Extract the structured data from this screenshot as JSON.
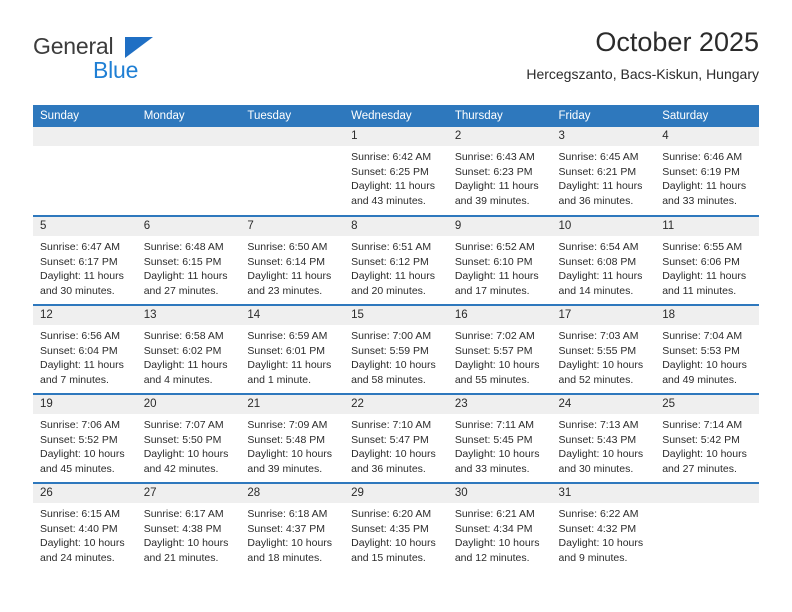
{
  "logo": {
    "word1": "General",
    "word2": "Blue",
    "triangle_color": "#1f6fc4",
    "word2_color": "#1f7fd4"
  },
  "header": {
    "title": "October 2025",
    "subtitle": "Hercegszanto, Bacs-Kiskun, Hungary"
  },
  "theme": {
    "header_blue": "#2e78bd",
    "daynum_gray": "#efefef",
    "text": "#2b2b2b"
  },
  "weekday_headers": [
    "Sunday",
    "Monday",
    "Tuesday",
    "Wednesday",
    "Thursday",
    "Friday",
    "Saturday"
  ],
  "weeks": [
    [
      {
        "day": "",
        "sunrise": "",
        "sunset": "",
        "daylight": ""
      },
      {
        "day": "",
        "sunrise": "",
        "sunset": "",
        "daylight": ""
      },
      {
        "day": "",
        "sunrise": "",
        "sunset": "",
        "daylight": ""
      },
      {
        "day": "1",
        "sunrise": "Sunrise: 6:42 AM",
        "sunset": "Sunset: 6:25 PM",
        "daylight": "Daylight: 11 hours and 43 minutes."
      },
      {
        "day": "2",
        "sunrise": "Sunrise: 6:43 AM",
        "sunset": "Sunset: 6:23 PM",
        "daylight": "Daylight: 11 hours and 39 minutes."
      },
      {
        "day": "3",
        "sunrise": "Sunrise: 6:45 AM",
        "sunset": "Sunset: 6:21 PM",
        "daylight": "Daylight: 11 hours and 36 minutes."
      },
      {
        "day": "4",
        "sunrise": "Sunrise: 6:46 AM",
        "sunset": "Sunset: 6:19 PM",
        "daylight": "Daylight: 11 hours and 33 minutes."
      }
    ],
    [
      {
        "day": "5",
        "sunrise": "Sunrise: 6:47 AM",
        "sunset": "Sunset: 6:17 PM",
        "daylight": "Daylight: 11 hours and 30 minutes."
      },
      {
        "day": "6",
        "sunrise": "Sunrise: 6:48 AM",
        "sunset": "Sunset: 6:15 PM",
        "daylight": "Daylight: 11 hours and 27 minutes."
      },
      {
        "day": "7",
        "sunrise": "Sunrise: 6:50 AM",
        "sunset": "Sunset: 6:14 PM",
        "daylight": "Daylight: 11 hours and 23 minutes."
      },
      {
        "day": "8",
        "sunrise": "Sunrise: 6:51 AM",
        "sunset": "Sunset: 6:12 PM",
        "daylight": "Daylight: 11 hours and 20 minutes."
      },
      {
        "day": "9",
        "sunrise": "Sunrise: 6:52 AM",
        "sunset": "Sunset: 6:10 PM",
        "daylight": "Daylight: 11 hours and 17 minutes."
      },
      {
        "day": "10",
        "sunrise": "Sunrise: 6:54 AM",
        "sunset": "Sunset: 6:08 PM",
        "daylight": "Daylight: 11 hours and 14 minutes."
      },
      {
        "day": "11",
        "sunrise": "Sunrise: 6:55 AM",
        "sunset": "Sunset: 6:06 PM",
        "daylight": "Daylight: 11 hours and 11 minutes."
      }
    ],
    [
      {
        "day": "12",
        "sunrise": "Sunrise: 6:56 AM",
        "sunset": "Sunset: 6:04 PM",
        "daylight": "Daylight: 11 hours and 7 minutes."
      },
      {
        "day": "13",
        "sunrise": "Sunrise: 6:58 AM",
        "sunset": "Sunset: 6:02 PM",
        "daylight": "Daylight: 11 hours and 4 minutes."
      },
      {
        "day": "14",
        "sunrise": "Sunrise: 6:59 AM",
        "sunset": "Sunset: 6:01 PM",
        "daylight": "Daylight: 11 hours and 1 minute."
      },
      {
        "day": "15",
        "sunrise": "Sunrise: 7:00 AM",
        "sunset": "Sunset: 5:59 PM",
        "daylight": "Daylight: 10 hours and 58 minutes."
      },
      {
        "day": "16",
        "sunrise": "Sunrise: 7:02 AM",
        "sunset": "Sunset: 5:57 PM",
        "daylight": "Daylight: 10 hours and 55 minutes."
      },
      {
        "day": "17",
        "sunrise": "Sunrise: 7:03 AM",
        "sunset": "Sunset: 5:55 PM",
        "daylight": "Daylight: 10 hours and 52 minutes."
      },
      {
        "day": "18",
        "sunrise": "Sunrise: 7:04 AM",
        "sunset": "Sunset: 5:53 PM",
        "daylight": "Daylight: 10 hours and 49 minutes."
      }
    ],
    [
      {
        "day": "19",
        "sunrise": "Sunrise: 7:06 AM",
        "sunset": "Sunset: 5:52 PM",
        "daylight": "Daylight: 10 hours and 45 minutes."
      },
      {
        "day": "20",
        "sunrise": "Sunrise: 7:07 AM",
        "sunset": "Sunset: 5:50 PM",
        "daylight": "Daylight: 10 hours and 42 minutes."
      },
      {
        "day": "21",
        "sunrise": "Sunrise: 7:09 AM",
        "sunset": "Sunset: 5:48 PM",
        "daylight": "Daylight: 10 hours and 39 minutes."
      },
      {
        "day": "22",
        "sunrise": "Sunrise: 7:10 AM",
        "sunset": "Sunset: 5:47 PM",
        "daylight": "Daylight: 10 hours and 36 minutes."
      },
      {
        "day": "23",
        "sunrise": "Sunrise: 7:11 AM",
        "sunset": "Sunset: 5:45 PM",
        "daylight": "Daylight: 10 hours and 33 minutes."
      },
      {
        "day": "24",
        "sunrise": "Sunrise: 7:13 AM",
        "sunset": "Sunset: 5:43 PM",
        "daylight": "Daylight: 10 hours and 30 minutes."
      },
      {
        "day": "25",
        "sunrise": "Sunrise: 7:14 AM",
        "sunset": "Sunset: 5:42 PM",
        "daylight": "Daylight: 10 hours and 27 minutes."
      }
    ],
    [
      {
        "day": "26",
        "sunrise": "Sunrise: 6:15 AM",
        "sunset": "Sunset: 4:40 PM",
        "daylight": "Daylight: 10 hours and 24 minutes."
      },
      {
        "day": "27",
        "sunrise": "Sunrise: 6:17 AM",
        "sunset": "Sunset: 4:38 PM",
        "daylight": "Daylight: 10 hours and 21 minutes."
      },
      {
        "day": "28",
        "sunrise": "Sunrise: 6:18 AM",
        "sunset": "Sunset: 4:37 PM",
        "daylight": "Daylight: 10 hours and 18 minutes."
      },
      {
        "day": "29",
        "sunrise": "Sunrise: 6:20 AM",
        "sunset": "Sunset: 4:35 PM",
        "daylight": "Daylight: 10 hours and 15 minutes."
      },
      {
        "day": "30",
        "sunrise": "Sunrise: 6:21 AM",
        "sunset": "Sunset: 4:34 PM",
        "daylight": "Daylight: 10 hours and 12 minutes."
      },
      {
        "day": "31",
        "sunrise": "Sunrise: 6:22 AM",
        "sunset": "Sunset: 4:32 PM",
        "daylight": "Daylight: 10 hours and 9 minutes."
      },
      {
        "day": "",
        "sunrise": "",
        "sunset": "",
        "daylight": ""
      }
    ]
  ]
}
